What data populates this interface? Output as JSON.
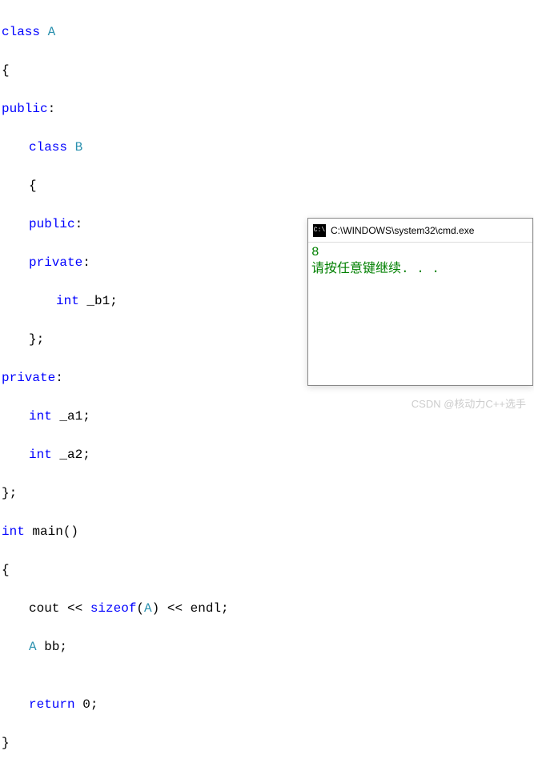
{
  "code": {
    "l1_kw": "class",
    "l1_type": " A",
    "l2": "{",
    "l3_kw": "public",
    "l3_punc": ":",
    "l4_kw": "class",
    "l4_type": " B",
    "l5": "{",
    "l6_kw": "public",
    "l6_punc": ":",
    "l7_kw": "private",
    "l7_punc": ":",
    "l8_kw": "int",
    "l8_ident": " _b1;",
    "l9": "};",
    "l10_kw": "private",
    "l10_punc": ":",
    "l11_kw": "int",
    "l11_ident": " _a1;",
    "l12_kw": "int",
    "l12_ident": " _a2;",
    "l13": "};",
    "l14_kw": "int",
    "l14_fn": " main()",
    "l15": "{",
    "l16_a": "cout << ",
    "l16_kw": "sizeof",
    "l16_b": "(",
    "l16_type": "A",
    "l16_c": ") << endl;",
    "l17_type": "A",
    "l17_ident": " bb;",
    "l18": "",
    "l19_kw": "return",
    "l19_val": " 0;",
    "l20": "}"
  },
  "console": {
    "title": "C:\\WINDOWS\\system32\\cmd.exe",
    "icon_text": "C:\\",
    "out1": "8",
    "out2": "请按任意键继续. . ."
  },
  "watermark": "CSDN @核动力C++选手"
}
